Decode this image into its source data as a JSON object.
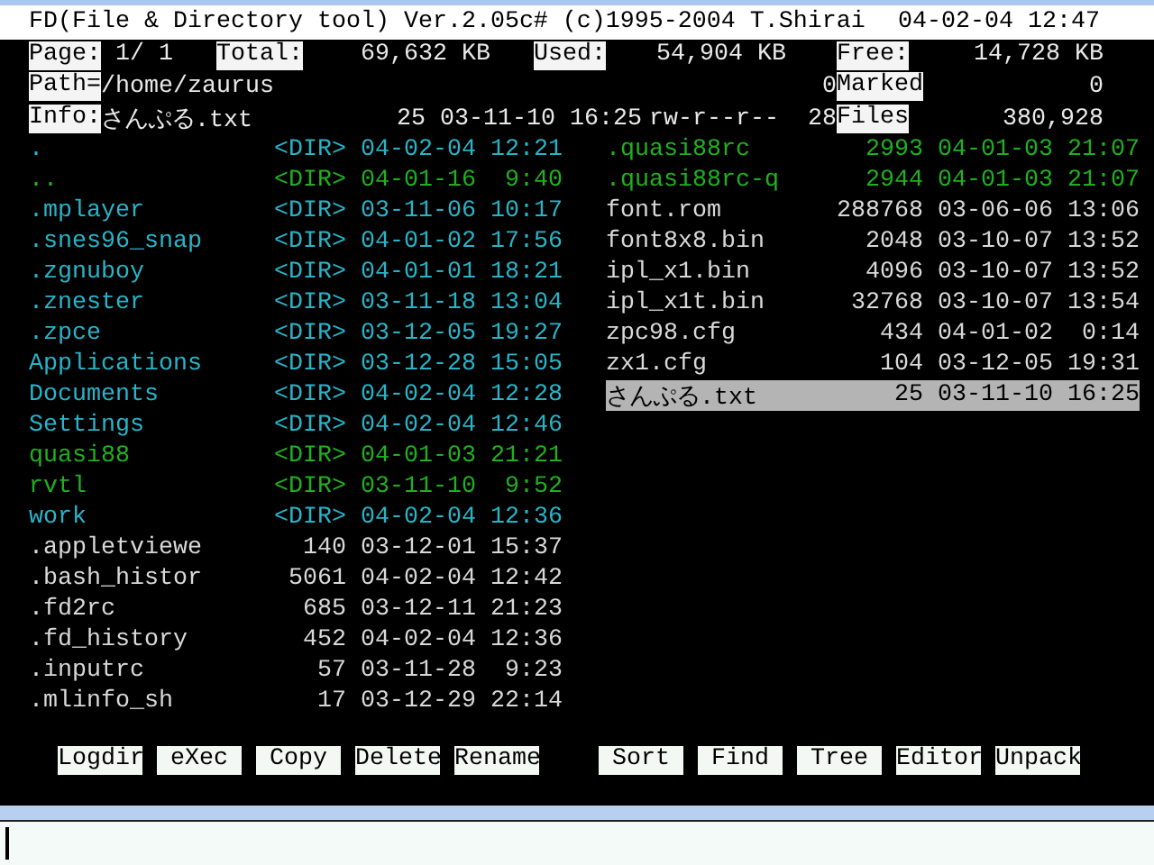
{
  "title_bar": {
    "title": "FD(File & Directory tool) Ver.2.05c# (c)1995-2004 T.Shirai",
    "datetime": "04-02-04 12:47"
  },
  "status": {
    "page_label": "Page:",
    "page": "1/ 1",
    "total_label": "Total:",
    "total": "69,632 KB",
    "used_label": "Used:",
    "used": "54,904 KB",
    "free_label": "Free:",
    "free": "14,728 KB",
    "path_label": "Path=",
    "path": "/home/zaurus",
    "path_count": "0",
    "marked_label": "Marked",
    "marked": "0",
    "info_label": "Info:",
    "info_name": "さんぷる.txt",
    "info_size": "25",
    "info_date": "03-11-10",
    "info_time": "16:25",
    "info_mode": "rw-r--r--",
    "info_count": "28",
    "files_label": "Files",
    "files": "380,928"
  },
  "panels": [
    {
      "files": [
        {
          "name": ".",
          "size": "<DIR>",
          "date": "04-02-04",
          "time": "12:21",
          "color": "#28b4c8",
          "selected": false
        },
        {
          "name": "..",
          "size": "<DIR>",
          "date": "04-01-16",
          "time": "9:40",
          "color": "#20b020",
          "selected": false
        },
        {
          "name": ".mplayer",
          "size": "<DIR>",
          "date": "03-11-06",
          "time": "10:17",
          "color": "#28b4c8",
          "selected": false
        },
        {
          "name": ".snes96_snap",
          "size": "<DIR>",
          "date": "04-01-02",
          "time": "17:56",
          "color": "#28b4c8",
          "selected": false
        },
        {
          "name": ".zgnuboy",
          "size": "<DIR>",
          "date": "04-01-01",
          "time": "18:21",
          "color": "#28b4c8",
          "selected": false
        },
        {
          "name": ".znester",
          "size": "<DIR>",
          "date": "03-11-18",
          "time": "13:04",
          "color": "#28b4c8",
          "selected": false
        },
        {
          "name": ".zpce",
          "size": "<DIR>",
          "date": "03-12-05",
          "time": "19:27",
          "color": "#28b4c8",
          "selected": false
        },
        {
          "name": "Applications",
          "size": "<DIR>",
          "date": "03-12-28",
          "time": "15:05",
          "color": "#28b4c8",
          "selected": false
        },
        {
          "name": "Documents",
          "size": "<DIR>",
          "date": "04-02-04",
          "time": "12:28",
          "color": "#28b4c8",
          "selected": false
        },
        {
          "name": "Settings",
          "size": "<DIR>",
          "date": "04-02-04",
          "time": "12:46",
          "color": "#28b4c8",
          "selected": false
        },
        {
          "name": "quasi88",
          "size": "<DIR>",
          "date": "04-01-03",
          "time": "21:21",
          "color": "#20b020",
          "selected": false
        },
        {
          "name": "rvtl",
          "size": "<DIR>",
          "date": "03-11-10",
          "time": "9:52",
          "color": "#20b020",
          "selected": false
        },
        {
          "name": "work",
          "size": "<DIR>",
          "date": "04-02-04",
          "time": "12:36",
          "color": "#28b4c8",
          "selected": false
        },
        {
          "name": ".appletviewe",
          "size": "140",
          "date": "03-12-01",
          "time": "15:37",
          "color": "#d8d8d8",
          "selected": false
        },
        {
          "name": ".bash_histor",
          "size": "5061",
          "date": "04-02-04",
          "time": "12:42",
          "color": "#d8d8d8",
          "selected": false
        },
        {
          "name": ".fd2rc",
          "size": "685",
          "date": "03-12-11",
          "time": "21:23",
          "color": "#d8d8d8",
          "selected": false
        },
        {
          "name": ".fd_history",
          "size": "452",
          "date": "04-02-04",
          "time": "12:36",
          "color": "#d8d8d8",
          "selected": false
        },
        {
          "name": ".inputrc",
          "size": "57",
          "date": "03-11-28",
          "time": "9:23",
          "color": "#d8d8d8",
          "selected": false
        },
        {
          "name": ".mlinfo_sh",
          "size": "17",
          "date": "03-12-29",
          "time": "22:14",
          "color": "#d8d8d8",
          "selected": false
        }
      ]
    },
    {
      "files": [
        {
          "name": ".quasi88rc",
          "size": "2993",
          "date": "04-01-03",
          "time": "21:07",
          "color": "#20b020",
          "selected": false
        },
        {
          "name": ".quasi88rc-q",
          "size": "2944",
          "date": "04-01-03",
          "time": "21:07",
          "color": "#20b020",
          "selected": false
        },
        {
          "name": "font.rom",
          "size": "288768",
          "date": "03-06-06",
          "time": "13:06",
          "color": "#d8d8d8",
          "selected": false
        },
        {
          "name": "font8x8.bin",
          "size": "2048",
          "date": "03-10-07",
          "time": "13:52",
          "color": "#d8d8d8",
          "selected": false
        },
        {
          "name": "ipl_x1.bin",
          "size": "4096",
          "date": "03-10-07",
          "time": "13:52",
          "color": "#d8d8d8",
          "selected": false
        },
        {
          "name": "ipl_x1t.bin",
          "size": "32768",
          "date": "03-10-07",
          "time": "13:54",
          "color": "#d8d8d8",
          "selected": false
        },
        {
          "name": "zpc98.cfg",
          "size": "434",
          "date": "04-01-02",
          "time": "0:14",
          "color": "#d8d8d8",
          "selected": false
        },
        {
          "name": "zx1.cfg",
          "size": "104",
          "date": "03-12-05",
          "time": "19:31",
          "color": "#d8d8d8",
          "selected": false
        },
        {
          "name": "さんぷる.txt",
          "size": "25",
          "date": "03-11-10",
          "time": "16:25",
          "selected": true
        }
      ]
    }
  ],
  "function_keys": [
    "Logdir",
    "eXec",
    "Copy",
    "Delete",
    "Rename",
    "Sort",
    "Find",
    "Tree",
    "Editor",
    "Unpack"
  ]
}
